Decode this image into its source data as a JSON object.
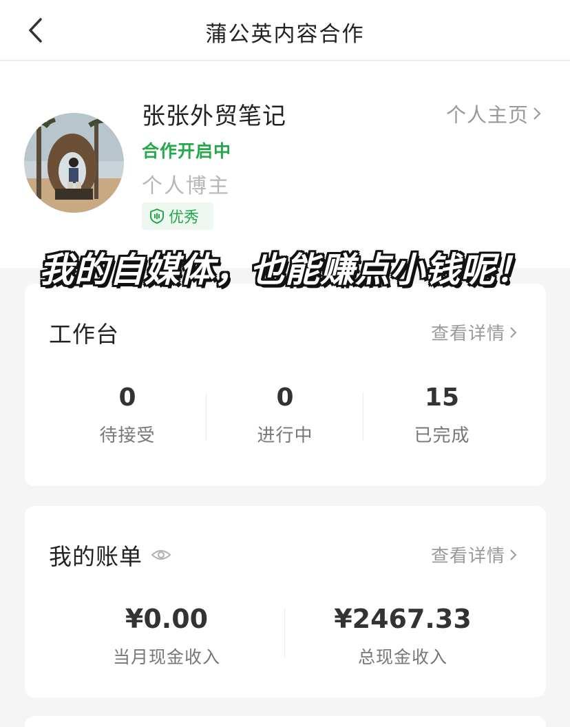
{
  "header": {
    "title": "蒲公英内容合作"
  },
  "profile": {
    "name": "张张外贸笔记",
    "status": "合作开启中",
    "type": "个人博主",
    "badge": "优秀",
    "home_link": "个人主页"
  },
  "banner": "我的自媒体，也能赚点小钱呢！",
  "workbench": {
    "title": "工作台",
    "link": "查看详情",
    "stats": [
      {
        "value": "0",
        "label": "待接受"
      },
      {
        "value": "0",
        "label": "进行中"
      },
      {
        "value": "15",
        "label": "已完成"
      }
    ]
  },
  "bill": {
    "title": "我的账单",
    "link": "查看详情",
    "items": [
      {
        "value": "¥0.00",
        "label": "当月现金收入"
      },
      {
        "value": "¥2467.33",
        "label": "总现金收入"
      }
    ]
  },
  "icons": {
    "back": "chevron-left-icon",
    "home_arrow": "chevron-right-icon",
    "badge": "shield-icon",
    "visibility": "eye-icon"
  },
  "colors": {
    "accent_green": "#23a84a",
    "badge_bg": "#eef8f0",
    "page_bg": "#f5f5f5"
  }
}
